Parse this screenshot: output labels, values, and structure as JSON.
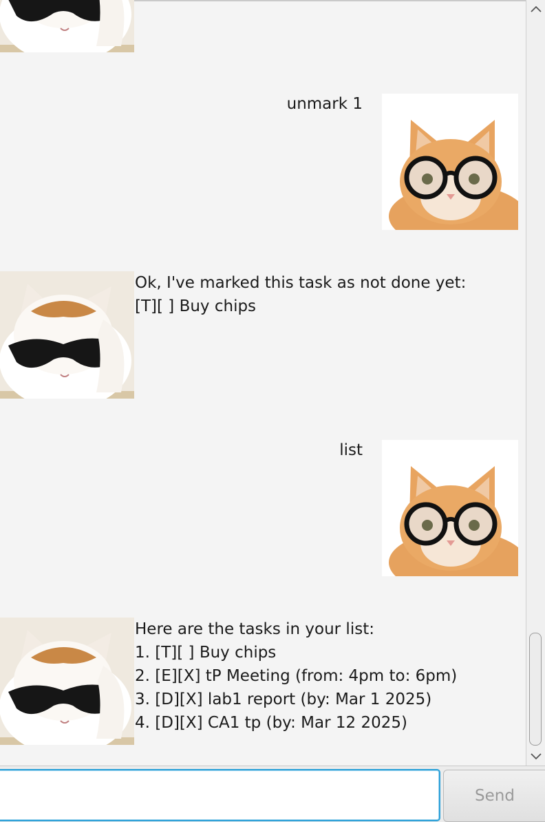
{
  "colors": {
    "background": "#f4f4f4",
    "input_focus": "#2aa0d8",
    "send_text": "#9a9a9a"
  },
  "messages": [
    {
      "sender": "user",
      "text": "unmark 1",
      "avatar": "cat-with-round-glasses"
    },
    {
      "sender": "bot",
      "text": "Ok, I've marked this task as not done yet:\n[T][ ] Buy chips",
      "avatar": "cat-with-sunglasses"
    },
    {
      "sender": "user",
      "text": "list",
      "avatar": "cat-with-round-glasses"
    },
    {
      "sender": "bot",
      "text": "Here are the tasks in your list:\n1. [T][ ] Buy chips\n2. [E][X] tP Meeting (from: 4pm to: 6pm)\n3. [D][X] lab1 report (by: Mar 1 2025)\n4. [D][X] CA1 tp (by: Mar 12 2025)",
      "avatar": "cat-with-sunglasses"
    }
  ],
  "input": {
    "value": "",
    "placeholder": ""
  },
  "send_button": {
    "label": "Send"
  },
  "scrollbar": {
    "position": "bottom",
    "up_icon": "chevron-up-icon",
    "down_icon": "chevron-down-icon"
  }
}
